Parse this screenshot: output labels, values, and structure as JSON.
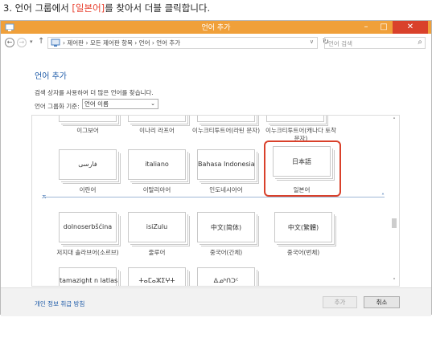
{
  "caption": {
    "prefix": "3. 언어 그룹에서 ",
    "highlight": "[일본어]",
    "suffix": "를 찾아서  더블 클릭합니다."
  },
  "window": {
    "title": "언어 추가",
    "controls": {
      "minimize": "–",
      "maximize": "□",
      "close": "✕"
    }
  },
  "address_bar": {
    "back": "←",
    "forward": "→",
    "recent": "▾",
    "up": "↑",
    "crumbs": "›  제어판  ›  모든 제어판 항목  ›  언어  ›  언어 추가",
    "dropdown": "∨",
    "refresh": "↻",
    "search_placeholder": "언어 검색",
    "search_icon": "⌕"
  },
  "main": {
    "title": "언어 추가",
    "description": "검색 상자를 사용하여 더 많은 언어를 찾습니다.",
    "group_label": "언어 그룹화 기준:",
    "group_value": "언어 이름",
    "group_arrow": "⌄"
  },
  "languages_top_partial": [
    {
      "label": "이그보어"
    },
    {
      "label": "이나리 라프어"
    },
    {
      "label": "이누크티투트어(라틴 문자)"
    },
    {
      "label": "이누크티투트어(캐나다 토착 문자)"
    }
  ],
  "languages_row1": [
    {
      "tile": "فارسی",
      "label": "이란어"
    },
    {
      "tile": "italiano",
      "label": "이탈리아어"
    },
    {
      "tile": "Bahasa Indonesia",
      "label": "인도네시아어"
    },
    {
      "tile": "日本語",
      "label": "일본어"
    }
  ],
  "group_separator": {
    "left": "ㅈ",
    "right": "˄"
  },
  "languages_row2": [
    {
      "tile": "dolnoserbšćina",
      "label": "저지대 솔라브어(소르브)"
    },
    {
      "tile": "isiZulu",
      "label": "줄루어"
    },
    {
      "tile": "中文(简体)",
      "label": "중국어(간체)"
    },
    {
      "tile": "中文(繁體)",
      "label": "중국어(번체)"
    }
  ],
  "languages_row3_partial": [
    {
      "tile": "tamazight n latlas"
    },
    {
      "tile": "ⵜⴰⵎⴰⵣⵉⵖⵜ"
    },
    {
      "tile": "ᐃᓄᒃᑎᑐᑦ"
    }
  ],
  "scrollbar": {
    "up": "˄",
    "down": "˅"
  },
  "footer": {
    "privacy": "개인 정보 취급 방침",
    "add": "추가",
    "cancel": "취소"
  },
  "colors": {
    "titlebar": "#f0a03a",
    "close": "#d9412b",
    "highlight": "#d9412b",
    "link": "#1e5ba8"
  }
}
